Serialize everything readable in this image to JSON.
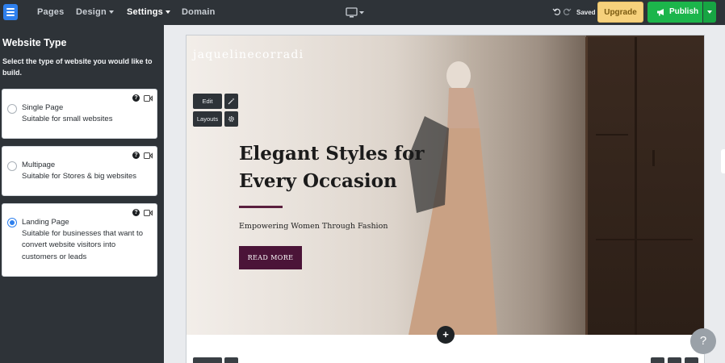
{
  "topbar": {
    "nav": [
      {
        "label": "Pages"
      },
      {
        "label": "Design"
      },
      {
        "label": "Settings"
      },
      {
        "label": "Domain"
      }
    ],
    "device_icon": "desktop-icon",
    "undo_icon": "undo-icon",
    "redo_icon": "redo-icon",
    "saved_label": "Saved",
    "upgrade_label": "Upgrade",
    "publish_label": "Publish",
    "colors": {
      "bar": "#2e3338",
      "publish": "#1cb54b",
      "upgrade": "#f6d17c",
      "logo": "#2f80ed"
    }
  },
  "sidebar": {
    "title": "Website Type",
    "description": "Select the type of website you would like to build.",
    "options": [
      {
        "title": "Single Page",
        "subtitle": "Suitable for small websites",
        "selected": false
      },
      {
        "title": "Multipage",
        "subtitle": "Suitable for Stores & big websites",
        "selected": false
      },
      {
        "title": "Landing Page",
        "subtitle": "Suitable for businesses that want to convert website visitors into customers or leads",
        "selected": true
      }
    ],
    "help_glyph": "?"
  },
  "preview": {
    "brand": "jaquelinecorradi",
    "edit_label": "Edit",
    "layouts_label": "Layouts",
    "hero_title": "Elegant Styles for Every Occasion",
    "hero_subtitle": "Empowering Women Through Fashion",
    "cta_label": "READ MORE",
    "add_glyph": "+",
    "accent": "#4b1438"
  },
  "help_fab": "?"
}
